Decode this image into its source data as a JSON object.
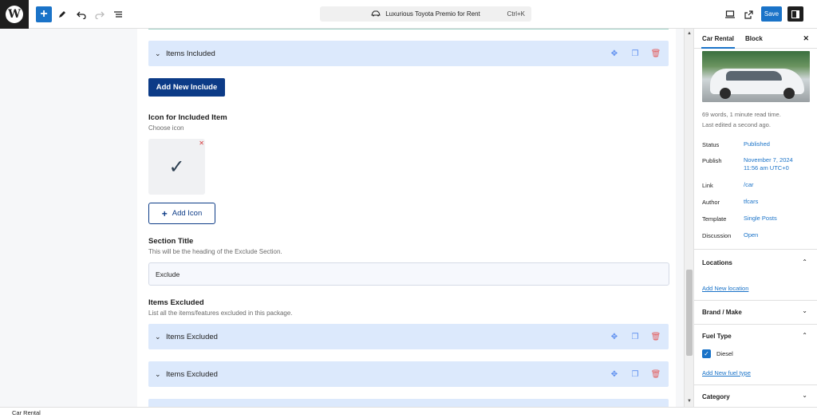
{
  "topbar": {
    "document_title": "Luxurious Toyota Premio for Rent",
    "shortcut": "Ctrl+K",
    "save_label": "Save"
  },
  "editor": {
    "accordions_top": [
      {
        "title": "Items Included"
      }
    ],
    "add_new_include": "Add New Include",
    "icon_section": {
      "label": "Icon for Included Item",
      "help": "Choose icon",
      "add_icon_label": "Add Icon"
    },
    "section_title": {
      "label": "Section Title",
      "help": "This will be the heading of the Exclude Section.",
      "value": "Exclude"
    },
    "items_excluded": {
      "label": "Items Excluded",
      "help": "List all the items/features excluded in this package.",
      "items": [
        {
          "title": "Items Excluded"
        },
        {
          "title": "Items Excluded"
        }
      ]
    }
  },
  "sidebar": {
    "tabs": [
      {
        "label": "Car Rental"
      },
      {
        "label": "Block"
      }
    ],
    "meta_words": "69 words, 1 minute read time.",
    "meta_edited": "Last edited a second ago.",
    "rows": [
      {
        "label": "Status",
        "value": "Published"
      },
      {
        "label": "Publish",
        "value": "November 7, 2024",
        "value2": "11:56 am UTC+0"
      },
      {
        "label": "Link",
        "value": "/car"
      },
      {
        "label": "Author",
        "value": "tfcars"
      },
      {
        "label": "Template",
        "value": "Single Posts"
      },
      {
        "label": "Discussion",
        "value": "Open"
      }
    ],
    "panels": {
      "locations": {
        "title": "Locations",
        "link": "Add New location"
      },
      "brand": {
        "title": "Brand / Make"
      },
      "fuel": {
        "title": "Fuel Type",
        "option": "Diesel",
        "link": "Add New fuel type"
      },
      "category": {
        "title": "Category"
      }
    }
  },
  "footer": {
    "breadcrumb": "Car Rental"
  },
  "colors": {
    "primary": "#0c3b87",
    "accent": "#1a73c8",
    "accordion_bg": "#dce9fc",
    "danger": "#e35d5d"
  }
}
